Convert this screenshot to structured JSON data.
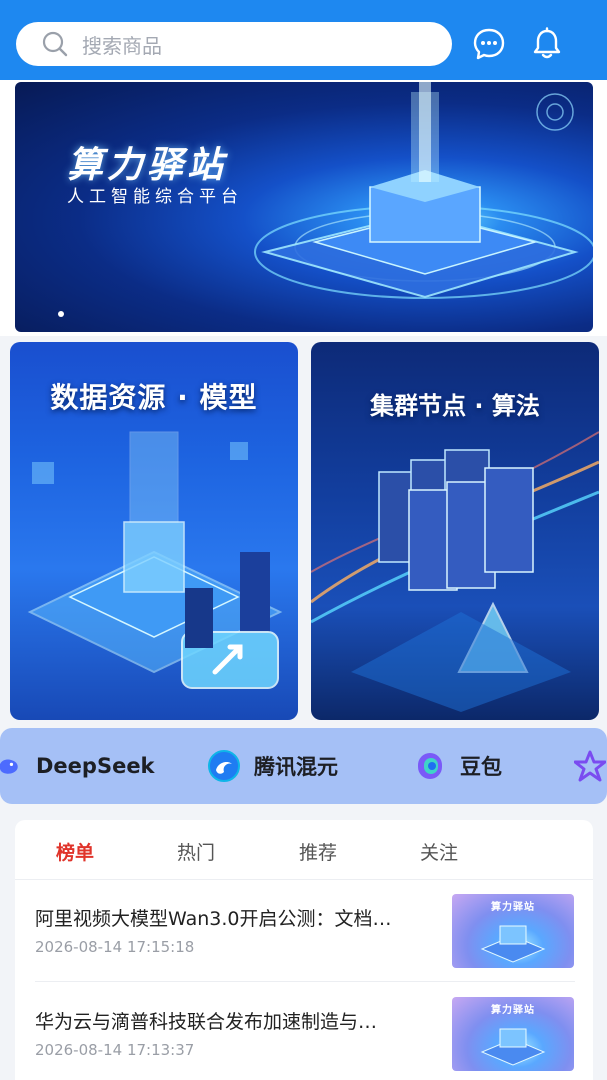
{
  "search": {
    "placeholder": "搜索商品"
  },
  "header": {
    "icons": [
      "chat-icon",
      "bell-icon"
    ],
    "accent": "#1e88f0"
  },
  "banner": {
    "title": "算力驿站",
    "subtitle": "人工智能综合平台"
  },
  "cards": [
    {
      "title": "数据资源 · 模型"
    },
    {
      "title": "集群节点 · 算法"
    }
  ],
  "models": [
    {
      "label": "DeepSeek"
    },
    {
      "label": "腾讯混元"
    },
    {
      "label": "豆包"
    }
  ],
  "tabs": [
    {
      "label": "榜单",
      "active": true
    },
    {
      "label": "热门"
    },
    {
      "label": "推荐"
    },
    {
      "label": "关注"
    }
  ],
  "news": [
    {
      "title": "阿里视频大模型Wan3.0开启公测：文档…",
      "time": "2026-08-14 17:15:18",
      "thumb_label": "算力驿站"
    },
    {
      "title": "华为云与滴普科技联合发布加速制造与…",
      "time": "2026-08-14 17:13:37",
      "thumb_label": "算力驿站"
    }
  ],
  "colors": {
    "active_tab": "#e0342b",
    "strip": "#a5c0f6"
  }
}
